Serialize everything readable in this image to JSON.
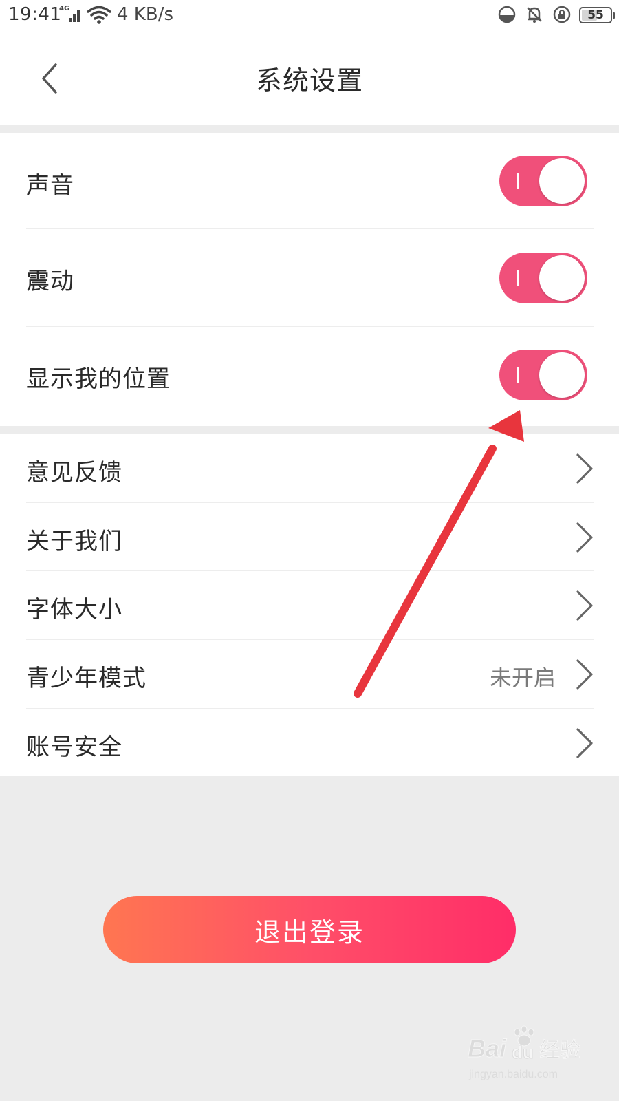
{
  "status_bar": {
    "time": "19:41",
    "network_tag": "4G",
    "speed": "4 KB/s",
    "battery_level": "55",
    "icons": [
      "data-saver-icon",
      "bell-mute-icon",
      "rotation-lock-icon",
      "battery-icon"
    ]
  },
  "nav": {
    "title": "系统设置",
    "back_icon": "chevron-left-icon"
  },
  "toggles": [
    {
      "label": "声音",
      "on": true
    },
    {
      "label": "震动",
      "on": true
    },
    {
      "label": "显示我的位置",
      "on": true
    }
  ],
  "links": [
    {
      "label": "意见反馈",
      "value": ""
    },
    {
      "label": "关于我们",
      "value": ""
    },
    {
      "label": "字体大小",
      "value": ""
    },
    {
      "label": "青少年模式",
      "value": "未开启"
    },
    {
      "label": "账号安全",
      "value": ""
    }
  ],
  "logout": {
    "label": "退出登录"
  },
  "colors": {
    "accent": "#f0507a",
    "logout_gradient_start": "#ff7651",
    "logout_gradient_end": "#ff2d68",
    "annotation": "#e8353d",
    "background": "#ececec"
  },
  "watermark": {
    "brand": "Bai",
    "brand_suffix": "du",
    "product": "经验",
    "url": "jingyan.baidu.com"
  }
}
